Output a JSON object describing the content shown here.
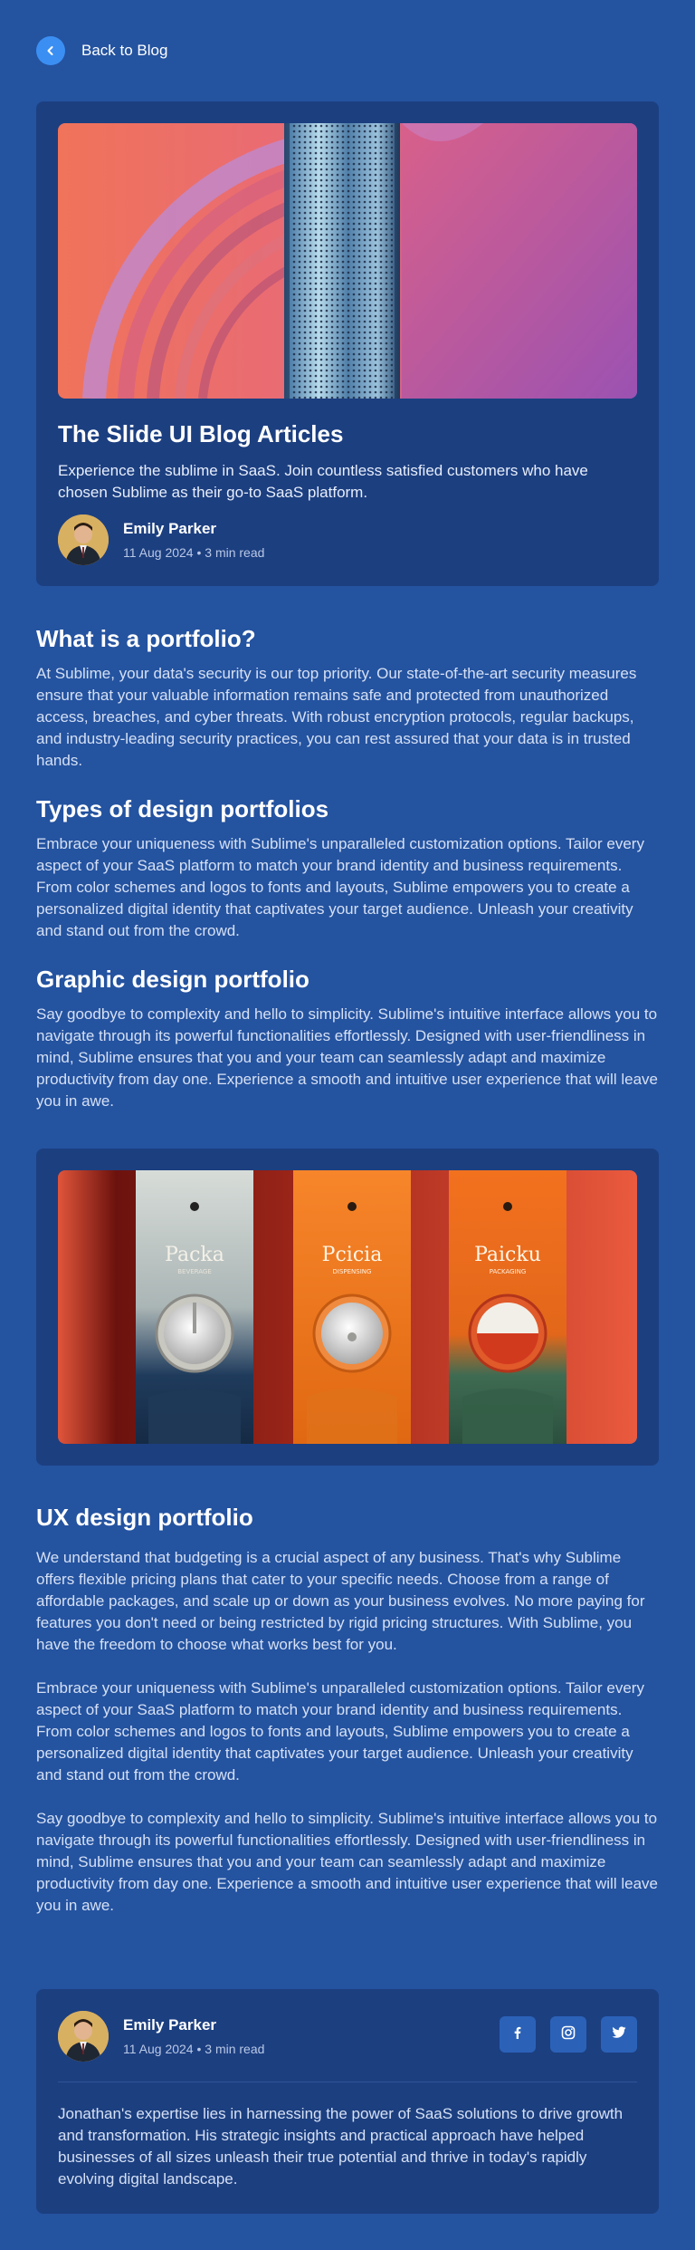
{
  "nav": {
    "back_label": "Back to Blog"
  },
  "hero": {
    "title": "The Slide UI Blog Articles",
    "description": "Experience the sublime in SaaS. Join countless satisfied customers who have chosen Sublime as their go-to SaaS platform.",
    "author": {
      "name": "Emily Parker",
      "meta": "11 Aug 2024 • 3 min read"
    }
  },
  "sections": [
    {
      "heading": "What is a portfolio?",
      "body": "At Sublime, your data's security is our top priority. Our state-of-the-art security measures ensure that your valuable information remains safe and protected from unauthorized access, breaches, and cyber threats. With robust encryption protocols, regular backups, and industry-leading security practices, you can rest assured that your data is in trusted hands."
    },
    {
      "heading": "Types of design portfolios",
      "body": "Embrace your uniqueness with Sublime's unparalleled customization options. Tailor every aspect of your SaaS platform to match your brand identity and business requirements. From color schemes and logos to fonts and layouts, Sublime empowers you to create a personalized digital identity that captivates your target audience. Unleash your creativity and stand out from the crowd."
    },
    {
      "heading": "Graphic design portfolio",
      "body": "Say goodbye to complexity and hello to simplicity. Sublime's intuitive interface allows you to navigate through its powerful functionalities effortlessly. Designed with user-friendliness in mind, Sublime ensures that you and your team can seamlessly adapt and maximize productivity from day one. Experience a smooth and intuitive user experience that will leave you in awe."
    }
  ],
  "gallery": {
    "labels": [
      "Packa",
      "Pcicia",
      "Paicku"
    ],
    "sublabels": [
      "BEVERAGE",
      "DISPENSING",
      "PACKAGING"
    ]
  },
  "ux": {
    "heading": "UX design portfolio",
    "paragraphs": [
      "We understand that budgeting is a crucial aspect of any business. That's why Sublime offers flexible pricing plans that cater to your specific needs. Choose from a range of affordable packages, and scale up or down as your business evolves. No more paying for features you don't need or being restricted by rigid pricing structures. With Sublime, you have the freedom to choose what works best for you.",
      "Embrace your uniqueness with Sublime's unparalleled customization options. Tailor every aspect of your SaaS platform to match your brand identity and business requirements. From color schemes and logos to fonts and layouts, Sublime empowers you to create a personalized digital identity that captivates your target audience. Unleash your creativity and stand out from the crowd.",
      "Say goodbye to complexity and hello to simplicity. Sublime's intuitive interface allows you to navigate through its powerful functionalities effortlessly. Designed with user-friendliness in mind, Sublime ensures that you and your team can seamlessly adapt and maximize productivity from day one. Experience a smooth and intuitive user experience that will leave you in awe."
    ]
  },
  "author_card": {
    "name": "Emily Parker",
    "meta": "11 Aug 2024 • 3 min read",
    "bio": "Jonathan's expertise lies in harnessing the power of SaaS solutions to drive growth and transformation. His strategic insights and practical approach have helped businesses of all sizes unleash their true potential and thrive in today's rapidly evolving digital landscape.",
    "socials": [
      "facebook-icon",
      "instagram-icon",
      "twitter-icon"
    ]
  },
  "colors": {
    "page_bg": "#2453a0",
    "card_bg": "#1c3f80",
    "accent": "#3b8ff3",
    "social_bg": "#2b62b8"
  }
}
